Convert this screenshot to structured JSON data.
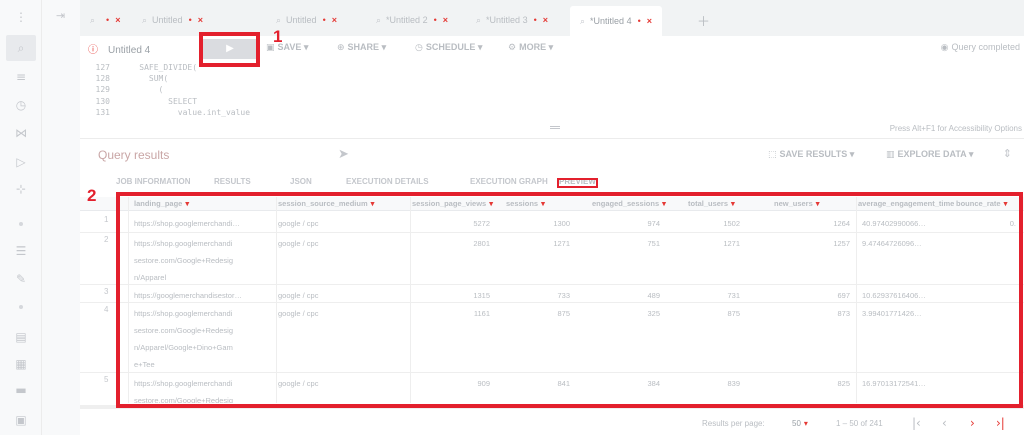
{
  "rail": {
    "icons": [
      "search-icon",
      "lines-icon",
      "history-icon",
      "share-icon",
      "pipeline-icon",
      "graph-icon",
      "settings-icon",
      "chart-icon",
      "table-icon",
      "lock-icon"
    ]
  },
  "tabs": [
    {
      "label": ""
    },
    {
      "label": "Untitled"
    },
    {
      "label": "Untitled"
    },
    {
      "label": "*Untitled 2"
    },
    {
      "label": "*Untitled 3"
    },
    {
      "label": "*Untitled 4"
    }
  ],
  "toolbar": {
    "title": "Untitled 4",
    "save_label": "SAVE",
    "share_label": "SHARE",
    "schedule_label": "SCHEDULE",
    "more_label": "MORE",
    "status": "Query completed"
  },
  "editor": {
    "lines": [
      {
        "n": "127",
        "text": "    SAFE_DIVIDE("
      },
      {
        "n": "128",
        "text": "      SUM("
      },
      {
        "n": "129",
        "text": "        ("
      },
      {
        "n": "130",
        "text": "          SELECT"
      },
      {
        "n": "131",
        "text": "            value.int_value"
      }
    ],
    "a11y_hint": "Press Alt+F1 for Accessibility Options"
  },
  "results": {
    "title": "Query results",
    "save_results": "SAVE RESULTS",
    "explore_data": "EXPLORE DATA",
    "tabs": [
      "JOB INFORMATION",
      "RESULTS",
      "JSON",
      "EXECUTION DETAILS",
      "EXECUTION GRAPH",
      "PREVIEW"
    ],
    "columns": [
      "landing_page",
      "session_source_medium",
      "session_page_views",
      "sessions",
      "engaged_sessions",
      "total_users",
      "new_users",
      "average_engagement_time",
      "bounce_rate"
    ],
    "rows": [
      {
        "n": "1",
        "cells": [
          "https://shop.googlemerchandi…",
          "google / cpc",
          "5272",
          "1300",
          "974",
          "1502",
          "1264",
          "40.97402990066…",
          "0."
        ]
      },
      {
        "n": "2",
        "cells": [
          "https://shop.googlemerchandi\nsestore.com/Google+Redesig\nn/Apparel",
          "google / cpc",
          "2801",
          "1271",
          "751",
          "1271",
          "1257",
          "9.47464726096…",
          ""
        ]
      },
      {
        "n": "3",
        "cells": [
          "https://googlemerchandisestor…",
          "google / cpc",
          "1315",
          "733",
          "489",
          "731",
          "697",
          "10.62937616406…",
          ""
        ]
      },
      {
        "n": "4",
        "cells": [
          "https://shop.googlemerchandi\nsestore.com/Google+Redesig\nn/Apparel/Google+Dino+Gam\ne+Tee",
          "google / cpc",
          "1161",
          "875",
          "325",
          "875",
          "873",
          "3.99401771426…",
          ""
        ]
      },
      {
        "n": "5",
        "cells": [
          "https://shop.googlemerchandi\nsestore.com/Google+Redesig",
          "google / cpc",
          "909",
          "841",
          "384",
          "839",
          "825",
          "16.97013172541…",
          ""
        ]
      }
    ]
  },
  "pager": {
    "label": "Results per page:",
    "per_page": "50",
    "range": "1 – 50 of 241"
  },
  "annotations": {
    "one": "1",
    "two": "2"
  }
}
